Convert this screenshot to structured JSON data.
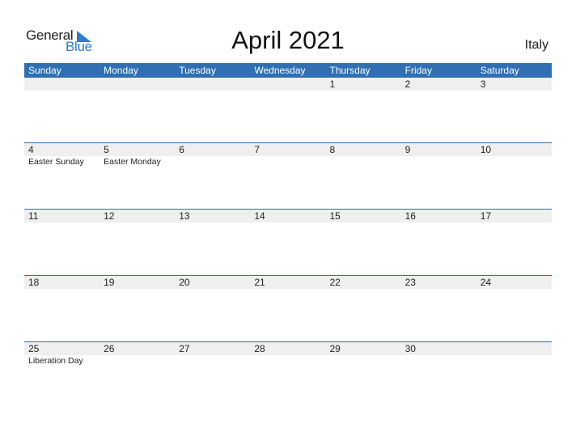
{
  "logo": {
    "part1": "General",
    "part2": "Blue"
  },
  "title": "April 2021",
  "country": "Italy",
  "colors": {
    "header": "#2f6fb2",
    "accent": "#2a7bd1",
    "row_band": "#efefef"
  },
  "weekdays": [
    "Sunday",
    "Monday",
    "Tuesday",
    "Wednesday",
    "Thursday",
    "Friday",
    "Saturday"
  ],
  "weeks": [
    {
      "days": [
        "",
        "",
        "",
        "",
        "1",
        "2",
        "3"
      ],
      "holidays": [
        "",
        "",
        "",
        "",
        "",
        "",
        ""
      ]
    },
    {
      "days": [
        "4",
        "5",
        "6",
        "7",
        "8",
        "9",
        "10"
      ],
      "holidays": [
        "Easter Sunday",
        "Easter Monday",
        "",
        "",
        "",
        "",
        ""
      ]
    },
    {
      "days": [
        "11",
        "12",
        "13",
        "14",
        "15",
        "16",
        "17"
      ],
      "holidays": [
        "",
        "",
        "",
        "",
        "",
        "",
        ""
      ]
    },
    {
      "days": [
        "18",
        "19",
        "20",
        "21",
        "22",
        "23",
        "24"
      ],
      "holidays": [
        "",
        "",
        "",
        "",
        "",
        "",
        ""
      ]
    },
    {
      "days": [
        "25",
        "26",
        "27",
        "28",
        "29",
        "30",
        ""
      ],
      "holidays": [
        "Liberation Day",
        "",
        "",
        "",
        "",
        "",
        ""
      ]
    }
  ]
}
